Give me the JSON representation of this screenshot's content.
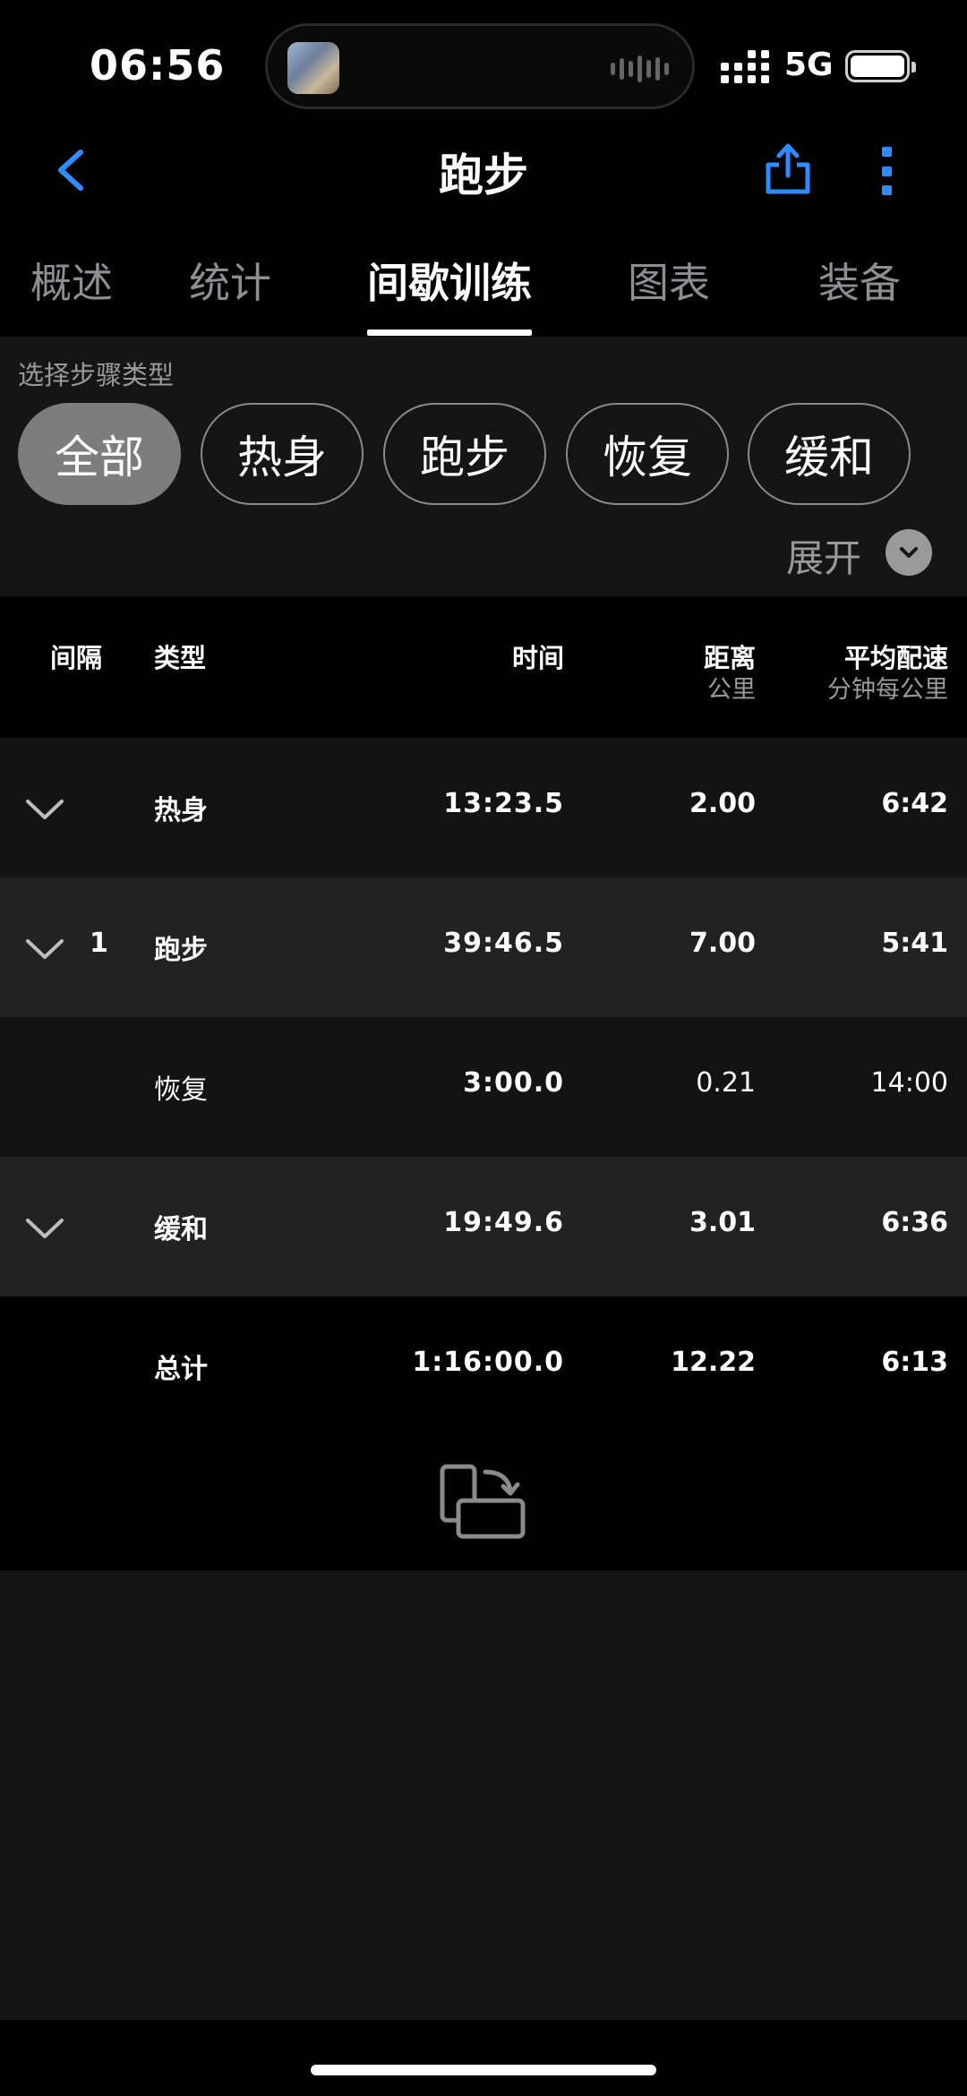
{
  "status_bar": {
    "time": "06:56",
    "network": "5G"
  },
  "nav": {
    "title": "跑步"
  },
  "tabs": [
    {
      "label": "概述"
    },
    {
      "label": "统计"
    },
    {
      "label": "间歇训练",
      "active": true
    },
    {
      "label": "图表"
    },
    {
      "label": "装备"
    }
  ],
  "filter": {
    "label": "选择步骤类型",
    "chips": [
      "全部",
      "热身",
      "跑步",
      "恢复",
      "缓和"
    ],
    "selected": "全部",
    "expand_label": "展开"
  },
  "table": {
    "headers": {
      "interval": "间隔",
      "type": "类型",
      "time": "时间",
      "distance": "距离",
      "distance_unit": "公里",
      "pace": "平均配速",
      "pace_unit": "分钟每公里"
    },
    "rows": [
      {
        "interval": "",
        "type": "热身",
        "time": "13:23.5",
        "distance": "2.00",
        "pace": "6:42",
        "expandable": true
      },
      {
        "interval": "1",
        "type": "跑步",
        "time": "39:46.5",
        "distance": "7.00",
        "pace": "5:41",
        "expandable": true
      },
      {
        "interval": "",
        "type": "恢复",
        "time": "3:00.0",
        "distance": "0.21",
        "pace": "14:00",
        "expandable": false
      },
      {
        "interval": "",
        "type": "缓和",
        "time": "19:49.6",
        "distance": "3.01",
        "pace": "6:36",
        "expandable": true
      }
    ],
    "total": {
      "type": "总计",
      "time": "1:16:00.0",
      "distance": "12.22",
      "pace": "6:13"
    }
  },
  "colors": {
    "accent": "#2f8cff",
    "background": "#000000",
    "panel": "#151515"
  },
  "icons": [
    "back-chevron-icon",
    "share-icon",
    "more-vertical-icon",
    "expand-down-icon",
    "row-chevron-icon",
    "rotate-screen-icon"
  ]
}
